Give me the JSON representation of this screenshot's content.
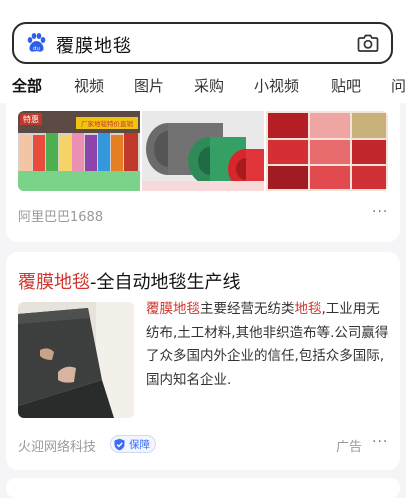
{
  "search": {
    "query": "覆膜地毯",
    "camera_icon": "camera-icon",
    "logo_icon": "baidu-paw-icon"
  },
  "tabs": [
    {
      "label": "全部",
      "active": true
    },
    {
      "label": "视频"
    },
    {
      "label": "图片"
    },
    {
      "label": "采购"
    },
    {
      "label": "小视频"
    },
    {
      "label": "贴吧"
    },
    {
      "label": "问"
    }
  ],
  "result1": {
    "source": "阿里巴巴1688",
    "more": "···",
    "image_labels": [
      "特惠",
      "厂家地毯特价直销"
    ]
  },
  "result2": {
    "title_highlight": "覆膜地毯",
    "title_rest": "-全自动地毯生产线",
    "desc_hl1": "覆膜地毯",
    "desc_p1": "主要经营无纺类",
    "desc_hl2": "地毯",
    "desc_p2": ",工业用无纺布,土工材料,其他非织造布等.公司赢得了众多国内外企业的信任,包括众多国际,国内知名企业.",
    "source": "火迎网络科技",
    "badge": "保障",
    "ad": "广告",
    "more": "···"
  },
  "colors": {
    "accent": "#3a6cf6",
    "highlight": "#d0342c",
    "muted": "#9a9a9a"
  }
}
